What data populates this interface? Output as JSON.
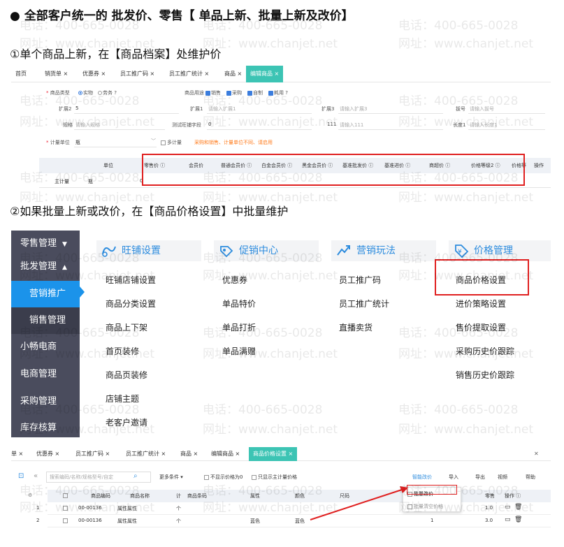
{
  "title": "●  全部客户统一的 批发价、零售【 单品上新、批量上新及改价】",
  "step1": "①单个商品上新，在【商品档案】处维护价",
  "step2": "②如果批量上新或改价，在【商品价格设置】中批量维护",
  "watermark": {
    "phone": "电话：400-665-0028",
    "site": "网址：www.chanjet.net"
  },
  "shot1": {
    "tabs": [
      "首页",
      "销货单 ×",
      "优惠券 ×",
      "员工推广码 ×",
      "员工推广统计 ×",
      "商品 ×",
      "编辑商品 ×"
    ],
    "form": {
      "product_type_label": "商品类型",
      "product_type_opt1": "实物",
      "product_type_opt2": "劳务",
      "usage_label": "商品用途",
      "usage_opts": [
        "销售",
        "采购",
        "自制",
        "耗用"
      ],
      "help": "?",
      "ext2_label": "扩展2",
      "ext2_value": "5",
      "ext1_label": "扩展1",
      "ext1_ph": "请输入扩展1",
      "ext3_label": "扩展3",
      "ext3_ph": "请输入扩展3",
      "batch_label": "拔号",
      "batch_ph": "请输入拔号",
      "spec_label": "规格",
      "spec_ph": "请输入规格",
      "test_label": "测试旺铺字段",
      "test_value": "0",
      "f111_label": "111",
      "f111_ph": "请输入111",
      "len_label": "长度1",
      "len_ph": "请输入长度1",
      "unit_label": "计量单位",
      "unit_value": "瓶",
      "multi_unit": "多计量",
      "unit_hint": "采购和销售、计量单位不同、请启用"
    },
    "table_headers": [
      "单位",
      "零售价 ⓘ",
      "会员价",
      "普通会员价 ⓘ",
      "白金会员价 ⓘ",
      "黑金会员价 ⓘ",
      "基准批发价 ⓘ",
      "基准进价 ⓘ",
      "商超价 ⓘ",
      "价格等级2 ⓘ",
      "价格等",
      "操作"
    ],
    "row_label": "主计量",
    "row_unit": "瓶",
    "row_zero": "0"
  },
  "shot2": {
    "sidebar": [
      "零售管理",
      "批发管理",
      "营销推广",
      "销售管理",
      "小畅电商",
      "电商管理",
      "采购管理",
      "库存核算"
    ],
    "caret_down": "▼",
    "caret_up": "▲",
    "columns": [
      {
        "title": "旺铺设置",
        "items": [
          "旺铺店铺设置",
          "商品分类设置",
          "商品上下架",
          "首页装修",
          "商品页装修",
          "店铺主题",
          "老客户邀请"
        ]
      },
      {
        "title": "促销中心",
        "items": [
          "优惠券",
          "单品特价",
          "单品打折",
          "单品满赠"
        ]
      },
      {
        "title": "营销玩法",
        "items": [
          "员工推广码",
          "员工推广统计",
          "直播卖货"
        ]
      },
      {
        "title": "价格管理",
        "items": [
          "商品价格设置",
          "进价策略设置",
          "售价提取设置",
          "采购历史价跟踪",
          "销售历史价跟踪"
        ]
      }
    ],
    "accent": "#2d8cde"
  },
  "shot3": {
    "tabs": [
      "单 ×",
      "优惠券 ×",
      "员工推广码 ×",
      "员工推广统计 ×",
      "商品 ×",
      "编辑商品 ×",
      "商品价格设置 ×"
    ],
    "search_ph": "搜索编码/名称/规格型号/自定",
    "more_filters": "更多条件 ▾",
    "opt_hide_zero": "不显示价格为0",
    "opt_main_unit": "只显示主计量价格",
    "smart_price": "智能改价",
    "import": "导入",
    "export": "导出",
    "view": "视频",
    "help": "帮助",
    "dropdown": [
      "批量改价",
      "批量清空价格"
    ],
    "headers": [
      "商品编码",
      "商品名称",
      "计",
      "商品条码",
      "属性",
      "颜色",
      "尺码",
      "",
      "零售",
      "零售",
      "操作 ⓘ"
    ],
    "rows": [
      {
        "idx": "1",
        "code": "00-00136",
        "name": "属性属性",
        "unit": "个",
        "attr": "",
        "color": "",
        "size": "",
        "retail": "",
        "r2": "1.0"
      },
      {
        "idx": "2",
        "code": "00-00136",
        "name": "属性属性",
        "unit": "个",
        "attr": "蓝色",
        "color": "蓝色",
        "size": "",
        "retail": "1",
        "r2": "3.0"
      }
    ]
  }
}
